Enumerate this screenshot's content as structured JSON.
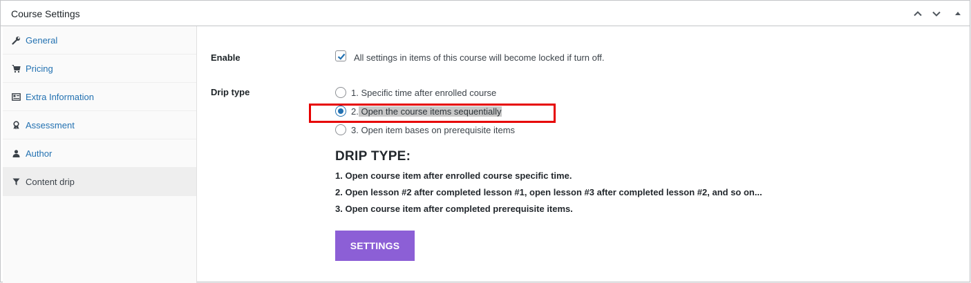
{
  "panel": {
    "title": "Course Settings",
    "controls": [
      "move-up-icon",
      "move-down-icon",
      "collapse-toggle-icon"
    ]
  },
  "sidebar": {
    "items": [
      {
        "label": "General",
        "icon": "wrench-icon",
        "active": false
      },
      {
        "label": "Pricing",
        "icon": "cart-icon",
        "active": false
      },
      {
        "label": "Extra Information",
        "icon": "id-card-icon",
        "active": false
      },
      {
        "label": "Assessment",
        "icon": "award-icon",
        "active": false
      },
      {
        "label": "Author",
        "icon": "user-icon",
        "active": false
      },
      {
        "label": "Content drip",
        "icon": "filter-icon",
        "active": true
      }
    ]
  },
  "enable": {
    "label": "Enable",
    "checked": true,
    "description": "All settings in items of this course will become locked if turn off."
  },
  "drip_type": {
    "label": "Drip type",
    "options": [
      {
        "number": "1.",
        "text": "Specific time after enrolled course",
        "checked": false
      },
      {
        "number": "2.",
        "text": "Open the course items sequentially",
        "checked": true
      },
      {
        "number": "3.",
        "text": "Open item bases on prerequisite items",
        "checked": false
      }
    ]
  },
  "info": {
    "heading": "DRIP TYPE:",
    "lines": [
      "1. Open course item after enrolled course specific time.",
      "2. Open lesson #2 after completed lesson #1, open lesson #3 after completed lesson #2, and so on...",
      "3. Open course item after completed prerequisite items."
    ]
  },
  "settings_button": {
    "label": "SETTINGS"
  },
  "colors": {
    "accent": "#2271b1",
    "button": "#8c5fd6",
    "highlight_box": "#e60000"
  }
}
